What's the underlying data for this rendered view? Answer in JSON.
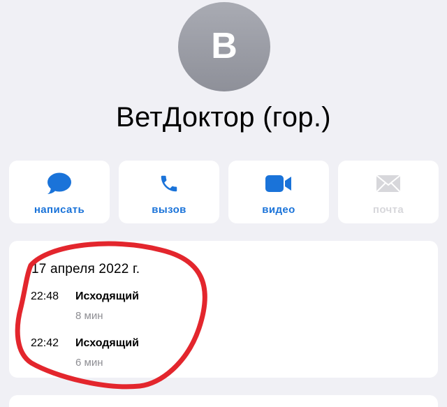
{
  "contact": {
    "initial": "В",
    "name": "ВетДоктор (гор.)"
  },
  "actions": [
    {
      "label": "написать",
      "icon": "message-bubble-icon",
      "enabled": true
    },
    {
      "label": "вызов",
      "icon": "phone-icon",
      "enabled": true
    },
    {
      "label": "видео",
      "icon": "video-camera-icon",
      "enabled": true
    },
    {
      "label": "почта",
      "icon": "envelope-icon",
      "enabled": false
    }
  ],
  "call_history": {
    "date": "17 апреля 2022 г.",
    "calls": [
      {
        "time": "22:48",
        "type": "Исходящий",
        "duration": "8 мин"
      },
      {
        "time": "22:42",
        "type": "Исходящий",
        "duration": "6 мин"
      }
    ]
  },
  "colors": {
    "accent": "#1a73d9",
    "disabled": "#d7d7db",
    "background": "#f0f0f5",
    "annotation": "#e3262d"
  }
}
